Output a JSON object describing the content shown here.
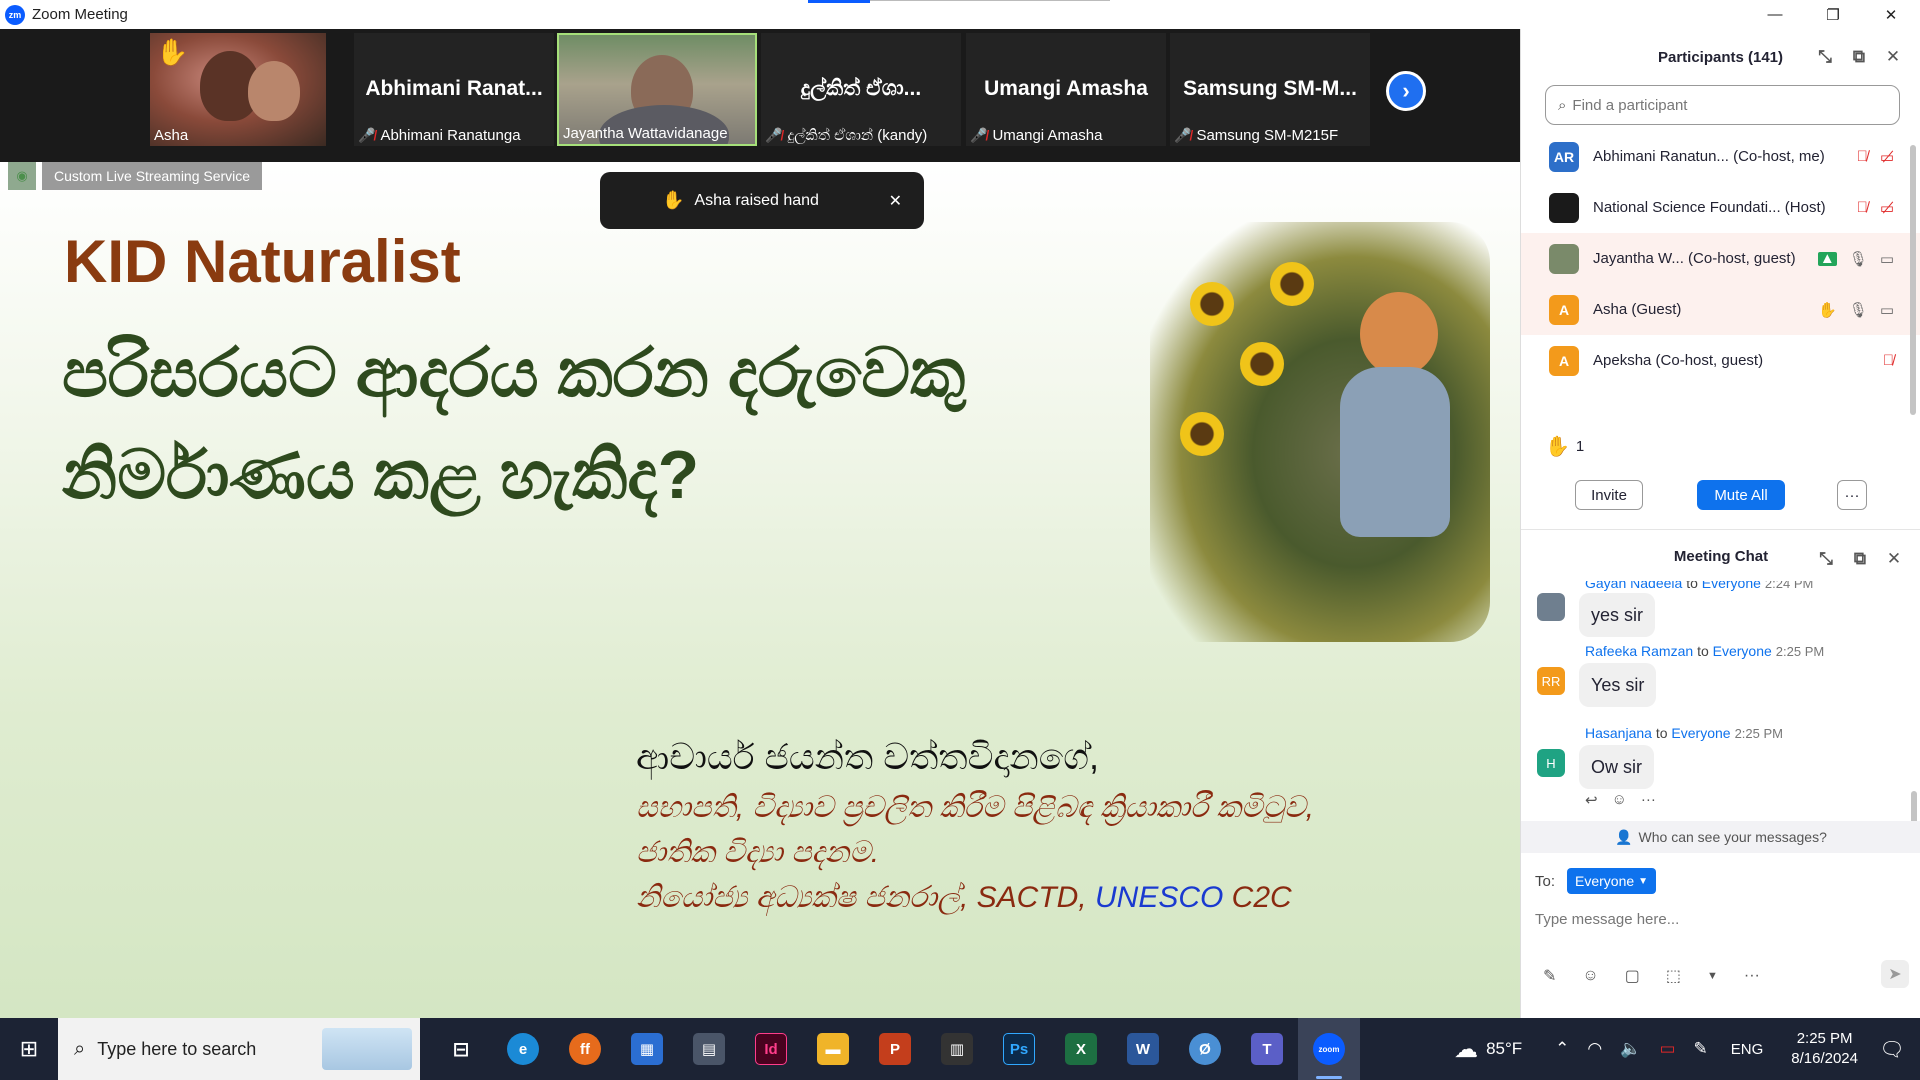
{
  "window": {
    "app_icon": "zm",
    "title": "Zoom Meeting",
    "controls": [
      "minimize-icon",
      "restore-icon",
      "close-icon"
    ]
  },
  "video_strip": {
    "tiles": [
      {
        "name_big": "",
        "caption": "Asha",
        "muted": false,
        "hand_raised": true,
        "has_video": true
      },
      {
        "name_big": "Abhimani  Ranat...",
        "caption": "Abhimani Ranatunga",
        "muted": true,
        "has_video": false
      },
      {
        "name_big": "",
        "caption": "Jayantha Wattavidanage",
        "muted": false,
        "has_video": true,
        "active_speaker": true
      },
      {
        "name_big": "දුල්කිත් ඒශා...",
        "caption": "දුල්කිත් ඒශාන් (kandy)",
        "muted": true,
        "has_video": false
      },
      {
        "name_big": "Umangi Amasha",
        "caption": "Umangi Amasha",
        "muted": true,
        "has_video": false
      },
      {
        "name_big": "Samsung  SM-M...",
        "caption": "Samsung SM-M215F",
        "muted": true,
        "has_video": false
      }
    ],
    "next_icon": "chevron-right-icon"
  },
  "share": {
    "stream_badge": "Custom Live Streaming Service",
    "toast": {
      "icon": "raised-hand-icon",
      "text": "Asha raised hand"
    },
    "slide": {
      "title": "KID Naturalist",
      "subtitle": "පරිසරයට ආදරය කරන දරුවෙකු නිර්මාණය කළ හැකිද?",
      "line1": "ආචාර්ය ජයන්ත වත්තවිදානගේ,",
      "line2": "සභාපති, විද්‍යාව ප්‍රචලිත කිරීම පිළිබඳ ක්‍රියාකාරී කමිටුව,",
      "line3": "ජාතික විද්‍යා පදනම.",
      "line4_prefix": "නියෝජ්‍ය අධ්‍යක්ෂ ජනරාල්, SACTD, ",
      "line4_blue": "UNESCO",
      "line4_suffix": "  C2C"
    }
  },
  "participants": {
    "header": "Participants (141)",
    "search_placeholder": "Find a participant",
    "list": [
      {
        "initials": "AR",
        "color": "#2d6fc9",
        "label": "Abhimani Ranatun... (Co-host, me)",
        "icons": [
          "mic-muted-icon",
          "video-off-icon"
        ]
      },
      {
        "initials": "",
        "color": "#1a1a1a",
        "label": "National Science Foundati... (Host)",
        "icons": [
          "mic-muted-icon",
          "video-off-icon"
        ]
      },
      {
        "initials": "",
        "color": "#7a8a6a",
        "label": "Jayantha W... (Co-host, guest)",
        "icons": [
          "share-screen-icon",
          "mic-icon",
          "video-icon"
        ],
        "raised_bg": true
      },
      {
        "initials": "A",
        "color": "#f39a1b",
        "label": "Asha (Guest)",
        "icons": [
          "raised-hand-icon",
          "mic-icon",
          "video-icon"
        ],
        "raised_bg": true
      },
      {
        "initials": "A",
        "color": "#f39a1b",
        "label": "Apeksha (Co-host, guest)",
        "icons": [
          "mic-muted-icon"
        ]
      }
    ],
    "raised_count": "1",
    "invite_label": "Invite",
    "mute_all_label": "Mute All",
    "more_label": "···"
  },
  "chat": {
    "header": "Meeting Chat",
    "messages": [
      {
        "sender": "Gayan Nadeela",
        "to": "to",
        "target": "Everyone",
        "time": "2:24 PM",
        "text": "yes sir",
        "avatar_initials": "",
        "avatar_color": "#6f7f8f"
      },
      {
        "sender": "Rafeeka Ramzan",
        "to": "to",
        "target": "Everyone",
        "time": "2:25 PM",
        "text": "Yes sir",
        "avatar_initials": "RR",
        "avatar_color": "#f39a1b"
      },
      {
        "sender": "Hasanjana",
        "to": "to",
        "target": "Everyone",
        "time": "2:25 PM",
        "text": "Ow sir",
        "avatar_initials": "H",
        "avatar_color": "#1fa383"
      }
    ],
    "visibility_text": "Who can see your messages?",
    "to_label": "To:",
    "to_value": "Everyone",
    "input_placeholder": "Type message here..."
  },
  "taskbar": {
    "search_placeholder": "Type here to search",
    "apps": [
      {
        "name": "task-view",
        "glyph": "⊟",
        "color": "transparent"
      },
      {
        "name": "edge",
        "glyph": "e",
        "color": "#1b8ad6"
      },
      {
        "name": "firefox",
        "glyph": "ff",
        "color": "#e66b1c"
      },
      {
        "name": "store",
        "glyph": "▦",
        "color": "#2b6ed2"
      },
      {
        "name": "calculator",
        "glyph": "▤",
        "color": "#4a5568"
      },
      {
        "name": "indesign",
        "glyph": "Id",
        "color": "#49021f"
      },
      {
        "name": "file-explorer",
        "glyph": "▬",
        "color": "#f0b429"
      },
      {
        "name": "powerpoint",
        "glyph": "P",
        "color": "#c43e1c"
      },
      {
        "name": "media",
        "glyph": "▥",
        "color": "#333333"
      },
      {
        "name": "photoshop",
        "glyph": "Ps",
        "color": "#0c2a4a"
      },
      {
        "name": "excel",
        "glyph": "X",
        "color": "#1d6f42"
      },
      {
        "name": "word",
        "glyph": "W",
        "color": "#2b579a"
      },
      {
        "name": "app-blue",
        "glyph": "Ø",
        "color": "#4a8fd4"
      },
      {
        "name": "teams",
        "glyph": "T",
        "color": "#5b5fc7"
      },
      {
        "name": "zoom",
        "glyph": "zoom",
        "color": "#0b5cff"
      }
    ],
    "temperature": "85°F",
    "language": "ENG",
    "time": "2:25 PM",
    "date": "8/16/2024"
  }
}
